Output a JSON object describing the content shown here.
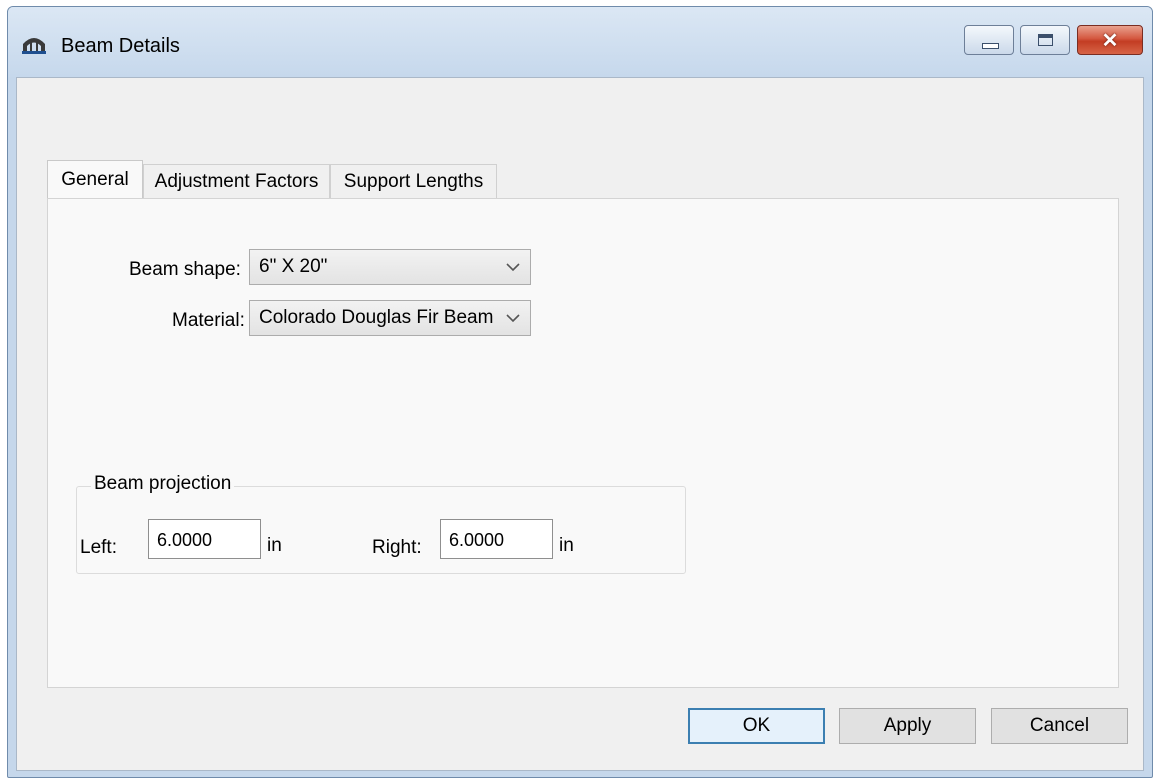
{
  "window": {
    "title": "Beam Details",
    "icon": "bridge-icon",
    "controls": {
      "minimize": "minimize-icon",
      "maximize": "maximize-icon",
      "close": "✕"
    }
  },
  "tabs": [
    {
      "label": "General",
      "active": true
    },
    {
      "label": "Adjustment Factors",
      "active": false
    },
    {
      "label": "Support Lengths",
      "active": false
    }
  ],
  "general": {
    "beam_shape": {
      "label": "Beam shape:",
      "value": "6\" X 20\""
    },
    "material": {
      "label": "Material:",
      "value": "Colorado Douglas Fir Beam"
    },
    "beam_projection": {
      "title": "Beam projection",
      "left": {
        "label": "Left:",
        "value": "6.0000",
        "unit": "in"
      },
      "right": {
        "label": "Right:",
        "value": "6.0000",
        "unit": "in"
      }
    }
  },
  "buttons": {
    "ok": "OK",
    "apply": "Apply",
    "cancel": "Cancel"
  },
  "colors": {
    "titlebar": "#c6d8ec",
    "close_button": "#c33d23",
    "default_button_border": "#3c7fb1"
  }
}
